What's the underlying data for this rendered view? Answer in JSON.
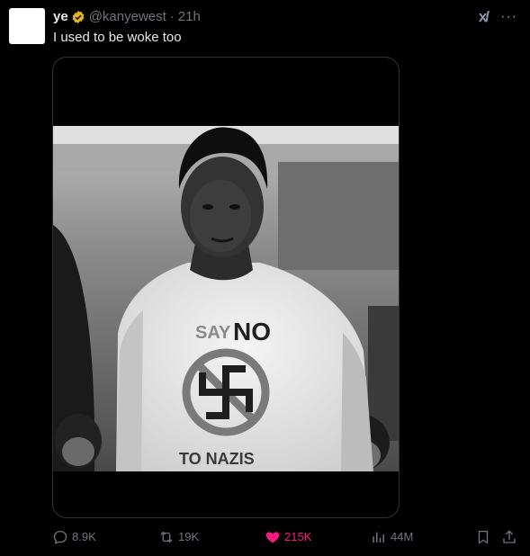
{
  "author": {
    "display_name": "ye",
    "handle": "@kanyewest",
    "separator": "·",
    "time": "21h",
    "verified_icon": "verified-badge-icon"
  },
  "tweet": {
    "text": "I used to be woke too"
  },
  "media": {
    "shirt_text_top_small": "SAY",
    "shirt_text_top_large": "NO",
    "shirt_text_bottom": "TO NAZIS"
  },
  "top_icons": {
    "grok_label": "x/",
    "more_label": "···"
  },
  "actions": {
    "replies": "8.9K",
    "reposts": "19K",
    "likes": "215K",
    "views": "44M"
  },
  "colors": {
    "background": "#000000",
    "text": "#e7e9ea",
    "muted": "#71767b",
    "like": "#f91880",
    "verified": "#e2b719"
  }
}
